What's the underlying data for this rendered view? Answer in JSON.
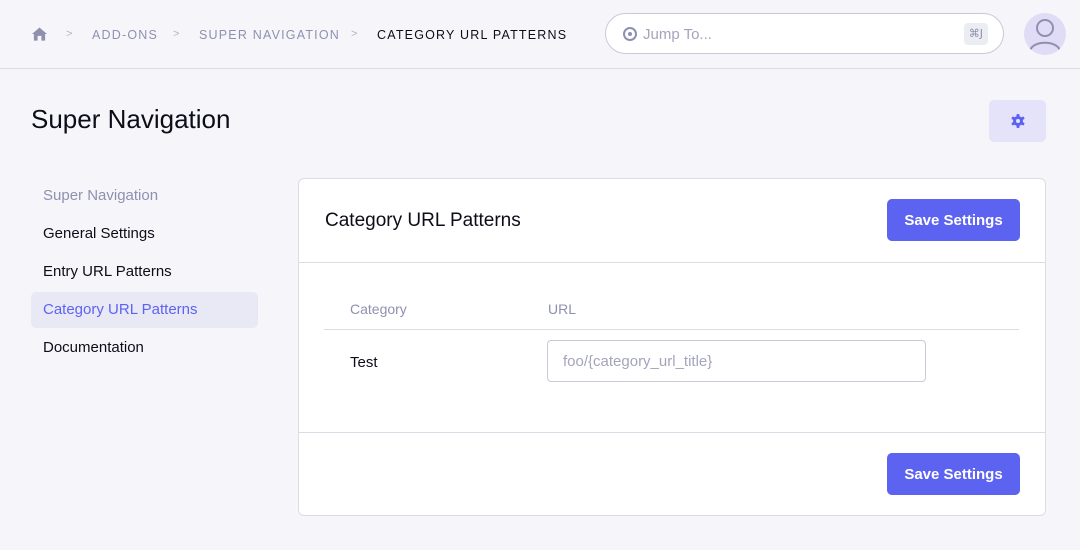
{
  "breadcrumb": {
    "home_icon": "home-icon",
    "separator": ">",
    "items": [
      "ADD-ONS",
      "SUPER NAVIGATION",
      "CATEGORY URL PATTERNS"
    ]
  },
  "jump": {
    "placeholder": "Jump To...",
    "shortcut": "⌘J"
  },
  "page": {
    "title": "Super Navigation"
  },
  "sidebar": {
    "header": "Super Navigation",
    "items": [
      {
        "label": "General Settings",
        "active": false
      },
      {
        "label": "Entry URL Patterns",
        "active": false
      },
      {
        "label": "Category URL Patterns",
        "active": true
      },
      {
        "label": "Documentation",
        "active": false
      }
    ]
  },
  "panel": {
    "title": "Category URL Patterns",
    "save_label": "Save Settings",
    "columns": [
      "Category",
      "URL"
    ],
    "rows": [
      {
        "category": "Test",
        "url_value": "",
        "url_placeholder": "foo/{category_url_title}"
      }
    ]
  },
  "colors": {
    "accent": "#5d63f1",
    "background": "#f6f6fa",
    "muted_text": "#8f90b0"
  }
}
